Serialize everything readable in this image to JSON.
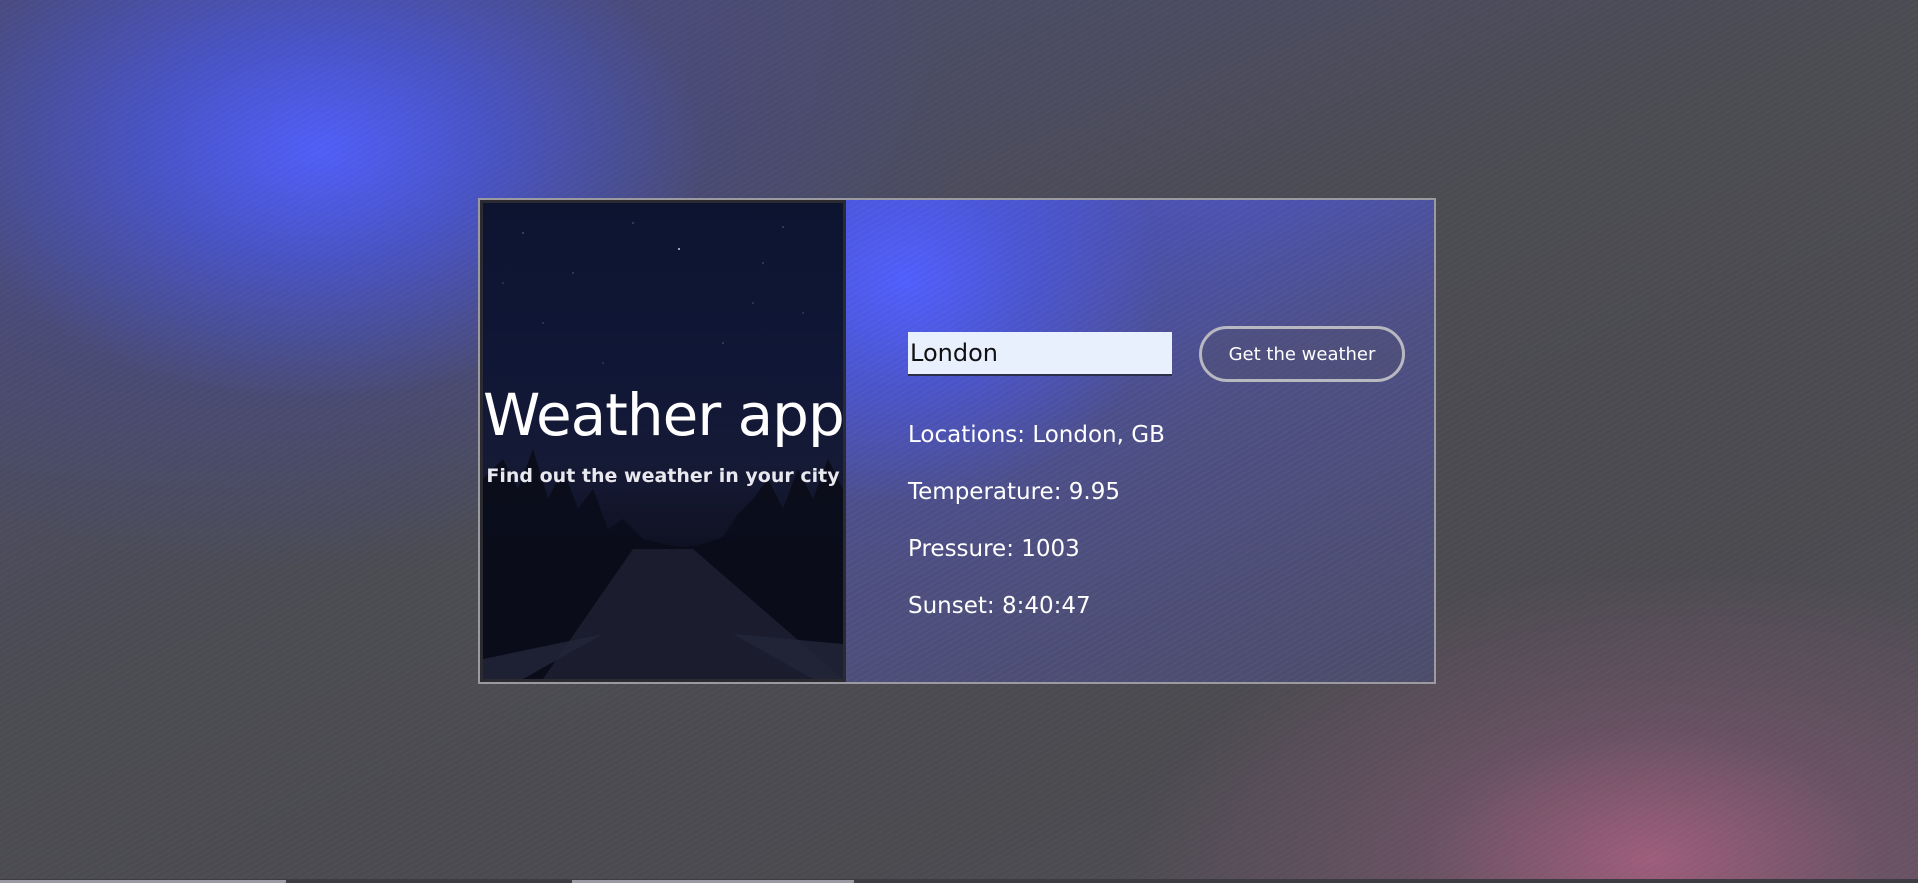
{
  "hero": {
    "title": "Weather app",
    "subtitle": "Find out the weather in your city"
  },
  "form": {
    "city_value": "London",
    "submit_label": "Get the weather"
  },
  "results": {
    "location": "Locations: London, GB",
    "temperature": "Temperature: 9.95",
    "pressure": "Pressure: 1003",
    "sunset": "Sunset: 8:40:47"
  },
  "colors": {
    "accent_blue": "#505fff",
    "accent_pink": "#aa5f82",
    "input_bg": "#e8f0fe"
  }
}
